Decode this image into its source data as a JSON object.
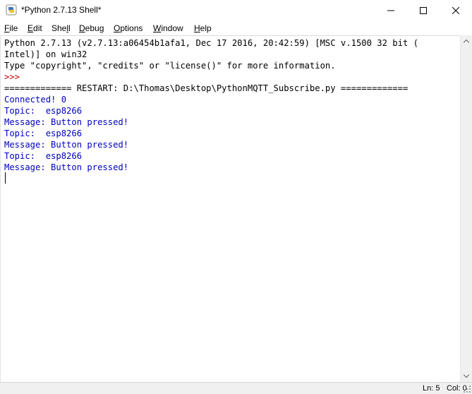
{
  "window": {
    "title": "*Python 2.7.13 Shell*"
  },
  "icons": {
    "app": "python-icon",
    "minimize": "minimize-icon",
    "maximize": "maximize-icon",
    "close": "close-icon",
    "scroll_up": "arrow-up-icon",
    "scroll_down": "arrow-down-icon",
    "grip": "resize-grip-icon"
  },
  "menu": {
    "items": [
      {
        "pre": "",
        "u": "F",
        "post": "ile"
      },
      {
        "pre": "",
        "u": "E",
        "post": "dit"
      },
      {
        "pre": "She",
        "u": "l",
        "post": "l"
      },
      {
        "pre": "",
        "u": "D",
        "post": "ebug"
      },
      {
        "pre": "",
        "u": "O",
        "post": "ptions"
      },
      {
        "pre": "",
        "u": "W",
        "post": "indow"
      },
      {
        "pre": "",
        "u": "H",
        "post": "elp"
      }
    ]
  },
  "shell": {
    "lines": [
      "Python 2.7.13 (v2.7.13:a06454b1afa1, Dec 17 2016, 20:42:59) [MSC v.1500 32 bit (",
      "Intel)] on win32",
      "Type \"copyright\", \"credits\" or \"license()\" for more information.",
      ">>> ",
      "============= RESTART: D:\\Thomas\\Desktop\\PythonMQTT_Subscribe.py =============",
      "Connected! 0",
      "Topic:  esp8266",
      "Message: Button pressed!",
      "Topic:  esp8266",
      "Message: Button pressed!",
      "Topic:  esp8266",
      "Message: Button pressed!"
    ]
  },
  "status": {
    "ln": "Ln: 5",
    "col": "Col: 0"
  },
  "colors": {
    "text": "#000000",
    "prompt": "#c00000",
    "output": "#0000c0"
  }
}
